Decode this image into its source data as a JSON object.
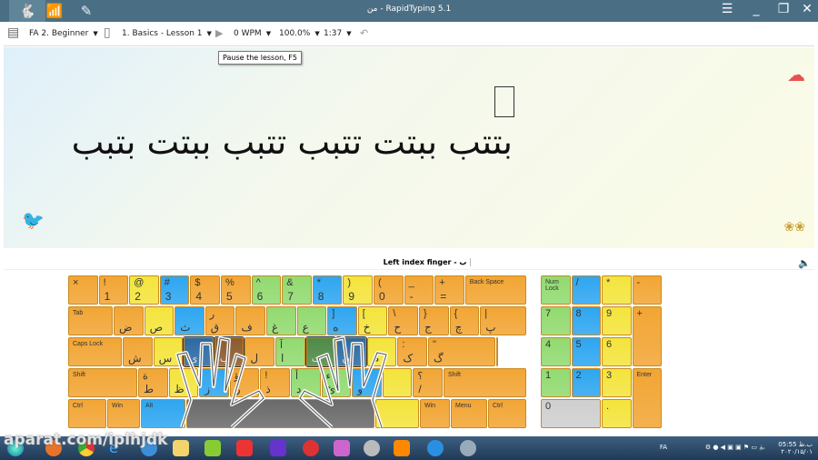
{
  "app": {
    "title": "من - RapidTyping  5.1"
  },
  "toolbar": {
    "course": "FA 2. Beginner",
    "lesson": "1. Basics - Lesson 1",
    "wpm": "0 WPM",
    "accuracy": "100.0%",
    "time": "1:37",
    "tooltip": "Pause the lesson, F5"
  },
  "lesson": {
    "text": "بتتب ببتت تتبب تتبب ببتت بتبب"
  },
  "finger": {
    "label": "Left index finger - ب"
  },
  "colors": {
    "o": "#f2a534",
    "y": "#f4e43c",
    "b": "#2ea6f0",
    "g": "#92da70",
    "B": "#2c6aa3",
    "br": "#8c5a2e",
    "G": "#4f8a48",
    "k": "#6a6a6a",
    "w": "#cfcfcf"
  },
  "keyboard": {
    "rows": [
      [
        [
          "×",
          "",
          "o"
        ],
        [
          "!",
          "1",
          "o"
        ],
        [
          "@",
          "2",
          "y"
        ],
        [
          "#",
          "3",
          "b"
        ],
        [
          "$",
          "4",
          "o"
        ],
        [
          "%",
          "5",
          "o"
        ],
        [
          "^",
          "6",
          "g"
        ],
        [
          "&",
          "7",
          "g"
        ],
        [
          "*",
          "8",
          "b"
        ],
        [
          ")",
          "9",
          "y"
        ],
        [
          "(",
          "0",
          "o"
        ],
        [
          "_",
          "-",
          "o"
        ],
        [
          "+",
          "=",
          "o"
        ],
        [
          "Back Space",
          "",
          "o"
        ]
      ],
      [
        [
          "Tab",
          "",
          "o"
        ],
        [
          "",
          "ض",
          "o"
        ],
        [
          "",
          "ص",
          "y"
        ],
        [
          "",
          "ث",
          "b"
        ],
        [
          "ر",
          "ق",
          "o"
        ],
        [
          "",
          "ف",
          "o"
        ],
        [
          "",
          "غ",
          "g"
        ],
        [
          "",
          "ع",
          "g"
        ],
        [
          "]",
          "ه",
          "b"
        ],
        [
          "[",
          "خ",
          "y"
        ],
        [
          "\\",
          "ح",
          "o"
        ],
        [
          "}",
          "ج",
          "o"
        ],
        [
          "{",
          "چ",
          "o"
        ],
        [
          "|",
          "پ",
          "o"
        ]
      ],
      [
        [
          "Caps Lock",
          "",
          "o"
        ],
        [
          "",
          "ش",
          "o"
        ],
        [
          "",
          "س",
          "y"
        ],
        [
          "",
          "ی",
          "B"
        ],
        [
          "",
          "ب",
          "br"
        ],
        [
          "",
          "ل",
          "o"
        ],
        [
          "آ",
          "ا",
          "g"
        ],
        [
          "",
          "ت",
          "G"
        ],
        [
          "",
          "ن",
          "B"
        ],
        [
          "",
          "م",
          "y"
        ],
        [
          ":",
          "ک",
          "o"
        ],
        [
          "\"",
          "گ",
          "o"
        ],
        [
          "Enter",
          "",
          "o"
        ]
      ],
      [
        [
          "Shift",
          "",
          "o"
        ],
        [
          "ة",
          "ط",
          "o"
        ],
        [
          "",
          "ظ",
          "y"
        ],
        [
          "",
          "ز",
          "b"
        ],
        [
          "ؤ",
          "ر",
          "o"
        ],
        [
          "!",
          "ذ",
          "o"
        ],
        [
          "أ",
          "د",
          "g"
        ],
        [
          "ء",
          "ئ",
          "g"
        ],
        [
          "",
          "و",
          "b"
        ],
        [
          "",
          "",
          "y"
        ],
        [
          "؟",
          "/",
          "o"
        ],
        [
          "Shift",
          "",
          "o"
        ]
      ],
      [
        [
          "Ctrl",
          "",
          "o"
        ],
        [
          "Win",
          "",
          "o"
        ],
        [
          "Alt",
          "",
          "b"
        ],
        [
          "",
          "",
          "k"
        ],
        [
          "",
          "",
          "y"
        ],
        [
          "Win",
          "",
          "o"
        ],
        [
          "Menu",
          "",
          "o"
        ],
        [
          "Ctrl",
          "",
          "o"
        ]
      ]
    ]
  },
  "numpad": {
    "keys": [
      [
        "Num Lock",
        "g"
      ],
      [
        "/",
        "b"
      ],
      [
        "*",
        "y"
      ],
      [
        "-",
        "o"
      ],
      [
        "7",
        "g"
      ],
      [
        "8",
        "b"
      ],
      [
        "9",
        "y"
      ],
      [
        "+",
        "o"
      ],
      [
        "4",
        "g"
      ],
      [
        "5",
        "b"
      ],
      [
        "6",
        "y"
      ],
      [
        "1",
        "g"
      ],
      [
        "2",
        "b"
      ],
      [
        "3",
        "y"
      ],
      [
        "Enter",
        "o"
      ],
      [
        "0",
        "w"
      ],
      [
        ".",
        "y"
      ]
    ]
  },
  "taskbar": {
    "watermark": "aparat.com/iplhjdk",
    "lang": "FA",
    "time": "05:55 ب.ظ",
    "date": "۲۰۲۰/۱۵/۰۱"
  }
}
